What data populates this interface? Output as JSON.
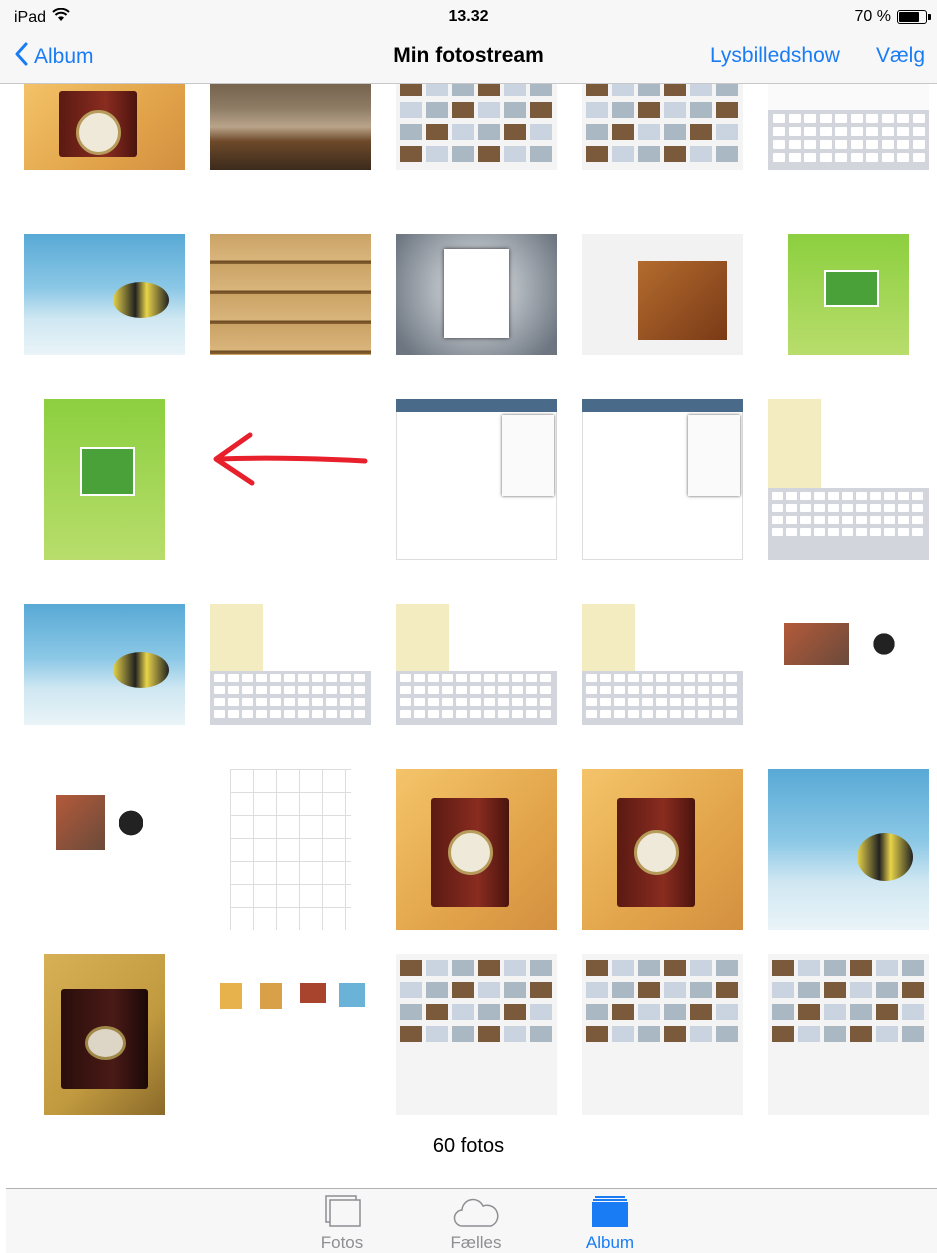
{
  "status": {
    "device": "iPad",
    "time": "13.32",
    "battery": "70 %"
  },
  "nav": {
    "back_label": "Album",
    "title": "Min fotostream",
    "slideshow": "Lysbilledshow",
    "select": "Vælg"
  },
  "photo_count": "60 fotos",
  "tabs": [
    {
      "label": "Fotos",
      "icon": "photos-stack-icon",
      "active": false
    },
    {
      "label": "Fælles",
      "icon": "cloud-icon",
      "active": false
    },
    {
      "label": "Album",
      "icon": "album-icon",
      "active": true
    }
  ],
  "thumbs": [
    {
      "name": "clock-photo",
      "kind": "clock-warm"
    },
    {
      "name": "office-desk-photo",
      "kind": "office"
    },
    {
      "name": "photos-grid-screenshot",
      "kind": "ui-grid"
    },
    {
      "name": "photos-grid-screenshot",
      "kind": "ui-grid"
    },
    {
      "name": "keyboard-screenshot",
      "kind": "keyboard"
    },
    {
      "name": "home-screen-fish",
      "kind": "fish"
    },
    {
      "name": "bookshelf-screenshot",
      "kind": "shelf"
    },
    {
      "name": "book-creator-getting-started",
      "kind": "getting-started"
    },
    {
      "name": "comic-room-screenshot",
      "kind": "comic"
    },
    {
      "name": "memory-game-screenshot",
      "kind": "green-game"
    },
    {
      "name": "memory-game-screenshot",
      "kind": "green-game"
    },
    {
      "name": "red-arrow-drawing",
      "kind": "arrow"
    },
    {
      "name": "book-creator-media-menu",
      "kind": "book-creator"
    },
    {
      "name": "book-creator-sound-menu",
      "kind": "book-creator"
    },
    {
      "name": "notes-keyboard-screenshot",
      "kind": "notes-kbd"
    },
    {
      "name": "home-screen-fish",
      "kind": "fish"
    },
    {
      "name": "notes-keyboard-screenshot",
      "kind": "notes-kbd"
    },
    {
      "name": "notes-keyboard-screenshot",
      "kind": "notes-kbd"
    },
    {
      "name": "mail-keyboard-screenshot",
      "kind": "notes-kbd"
    },
    {
      "name": "digitale-born-webpage",
      "kind": "web"
    },
    {
      "name": "digitale-born-webpage",
      "kind": "web"
    },
    {
      "name": "calendar-screenshot",
      "kind": "calendar"
    },
    {
      "name": "clock-photo",
      "kind": "clock-warm"
    },
    {
      "name": "clock-photo",
      "kind": "clock-warm"
    },
    {
      "name": "home-screen-fish",
      "kind": "fish"
    },
    {
      "name": "clock-photo",
      "kind": "clock-dark"
    },
    {
      "name": "album-list-screenshot",
      "kind": "album-list"
    },
    {
      "name": "photos-grid-screenshot",
      "kind": "ui-grid"
    },
    {
      "name": "photos-grid-screenshot",
      "kind": "ui-grid"
    },
    {
      "name": "photos-grid-screenshot",
      "kind": "ui-grid"
    }
  ],
  "colors": {
    "accent": "#1a7cf5",
    "bar": "#f7f7f7"
  }
}
